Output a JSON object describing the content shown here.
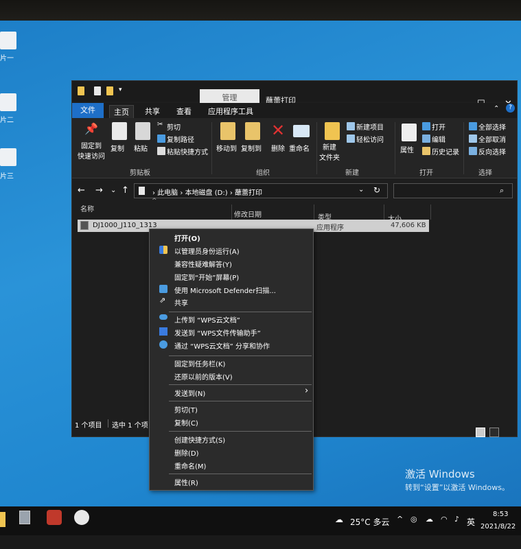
{
  "desktop": {
    "icons": [
      {
        "label": "片一"
      },
      {
        "label": "片二"
      },
      {
        "label": "片三"
      }
    ],
    "watermark": {
      "line1": "激活 Windows",
      "line2": "转到“设置”以激活 Windows。"
    }
  },
  "window": {
    "manage_tab": "管理",
    "title": "蘸蕾打印",
    "tabs": [
      "文件",
      "主页",
      "共享",
      "查看",
      "应用程序工具"
    ],
    "ribbon": {
      "clipboard": {
        "pin": "固定到\n快速访问",
        "copy": "复制",
        "paste": "粘贴",
        "cut": "剪切",
        "copy_path": "复制路径",
        "paste_shortcut": "粘贴快捷方式",
        "group": "剪贴板"
      },
      "organize": {
        "move_to": "移动到",
        "copy_to": "复制到",
        "delete": "删除",
        "rename": "重命名",
        "group": "组织"
      },
      "new": {
        "new_folder": "新建\n文件夹",
        "new_item": "新建项目",
        "easy_access": "轻松访问",
        "group": "新建"
      },
      "open": {
        "properties": "属性",
        "open": "打开",
        "edit": "编辑",
        "history": "历史记录",
        "group": "打开"
      },
      "select": {
        "select_all": "全部选择",
        "select_none": "全部取消",
        "invert": "反向选择",
        "group": "选择"
      }
    },
    "address": {
      "path": [
        "此电脑",
        "本地磁盘 (D:)",
        "蘸蕾打印"
      ]
    },
    "columns": {
      "name": "名称",
      "date": "修改日期",
      "type": "类型",
      "size": "大小"
    },
    "files": [
      {
        "name": "DJ1000_J110_1313",
        "type": "应用程序",
        "size": "47,606 KB"
      }
    ],
    "status": {
      "count": "1 个项目",
      "selected": "选中 1 个项"
    }
  },
  "context_menu": {
    "items": [
      {
        "label": "打开(O)",
        "icon": ""
      },
      {
        "label": "以管理员身份运行(A)",
        "icon": "shield-icon"
      },
      {
        "label": "兼容性疑难解答(Y)",
        "icon": ""
      },
      {
        "label": "固定到“开始”屏幕(P)",
        "icon": ""
      },
      {
        "label": "使用 Microsoft Defender扫描...",
        "icon": "defender-icon"
      },
      {
        "label": "共享",
        "icon": "share-icon"
      },
      {
        "label": "上传到 “WPS云文档”",
        "icon": "cloud-icon"
      },
      {
        "label": "发送到 “WPS文件传输助手”",
        "icon": "wps-transfer-icon"
      },
      {
        "label": "通过 “WPS云文档” 分享和协作",
        "icon": "wps-share-icon"
      },
      {
        "label": "固定到任务栏(K)",
        "icon": ""
      },
      {
        "label": "还原以前的版本(V)",
        "icon": ""
      },
      {
        "label": "发送到(N)",
        "icon": ""
      },
      {
        "label": "剪切(T)",
        "icon": ""
      },
      {
        "label": "复制(C)",
        "icon": ""
      },
      {
        "label": "创建快捷方式(S)",
        "icon": ""
      },
      {
        "label": "删除(D)",
        "icon": ""
      },
      {
        "label": "重命名(M)",
        "icon": ""
      },
      {
        "label": "属性(R)",
        "icon": ""
      }
    ]
  },
  "taskbar": {
    "weather": "25°C 多云",
    "ime": "英",
    "time": "8:53",
    "date": "2021/8/22"
  }
}
